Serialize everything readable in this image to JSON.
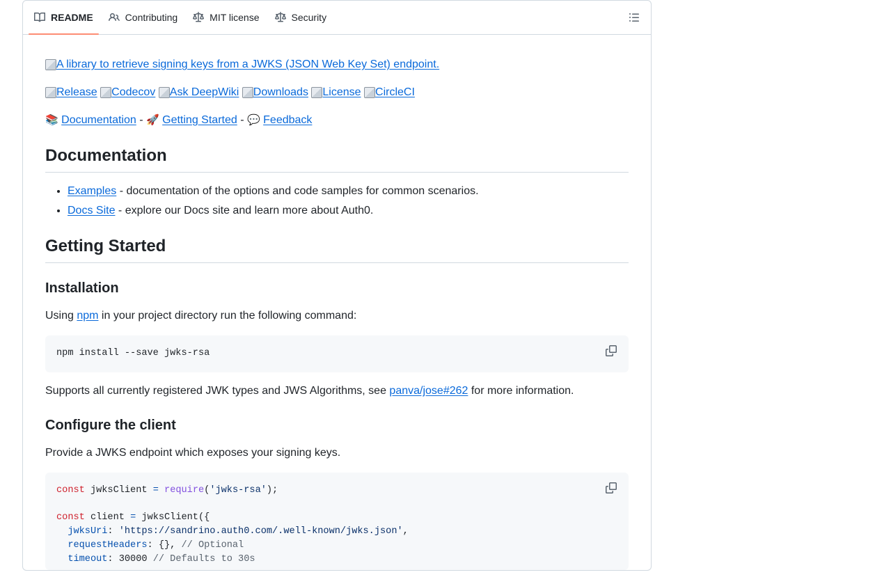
{
  "tabs": [
    {
      "label": "README",
      "icon": "book-icon",
      "active": true
    },
    {
      "label": "Contributing",
      "icon": "people-icon",
      "active": false
    },
    {
      "label": "MIT license",
      "icon": "law-icon",
      "active": false
    },
    {
      "label": "Security",
      "icon": "law-icon",
      "active": false
    }
  ],
  "toc_icon": "list-icon",
  "banner_alt": "A library to retrieve signing keys from a JWKS (JSON Web Key Set) endpoint.",
  "badges": [
    "Release",
    "Codecov",
    "Ask DeepWiki",
    "Downloads",
    "License",
    "CircleCI"
  ],
  "quicklinks": {
    "docs_emoji": "📚",
    "docs": "Documentation",
    "sep": "-",
    "start_emoji": "🚀",
    "start": "Getting Started",
    "feedback_emoji": "💬",
    "feedback": "Feedback"
  },
  "doc_section": {
    "heading": "Documentation",
    "items": [
      {
        "link": "Examples",
        "text": " - documentation of the options and code samples for common scenarios."
      },
      {
        "link": "Docs Site",
        "text": " - explore our Docs site and learn more about Auth0."
      }
    ]
  },
  "getting_started": {
    "heading": "Getting Started",
    "install_heading": "Installation",
    "install_pre": "Using ",
    "install_link": "npm",
    "install_post": " in your project directory run the following command:",
    "install_cmd": "npm install --save jwks-rsa",
    "supports_pre": "Supports all currently registered JWK types and JWS Algorithms, see ",
    "supports_link": "panva/jose#262",
    "supports_post": " for more information.",
    "configure_heading": "Configure the client",
    "configure_text": "Provide a JWKS endpoint which exposes your signing keys.",
    "code": {
      "l1_kw": "const",
      "l1_var": " jwksClient ",
      "l1_eq": "=",
      "l1_fn": " require",
      "l1_p1": "(",
      "l1_str": "'jwks-rsa'",
      "l1_p2": ");",
      "l3_kw": "const",
      "l3_var": " client ",
      "l3_eq": "=",
      "l3_rest": " jwksClient({",
      "l4_prop": "  jwksUri",
      "l4_colon": ": ",
      "l4_str": "'https://sandrino.auth0.com/.well-known/jwks.json'",
      "l4_end": ",",
      "l5_prop": "  requestHeaders",
      "l5_rest": ": {}, ",
      "l5_cm": "// Optional",
      "l6_prop": "  timeout",
      "l6_rest": ": 30000 ",
      "l6_cm": "// Defaults to 30s"
    }
  },
  "copy_icon": "copy-icon"
}
